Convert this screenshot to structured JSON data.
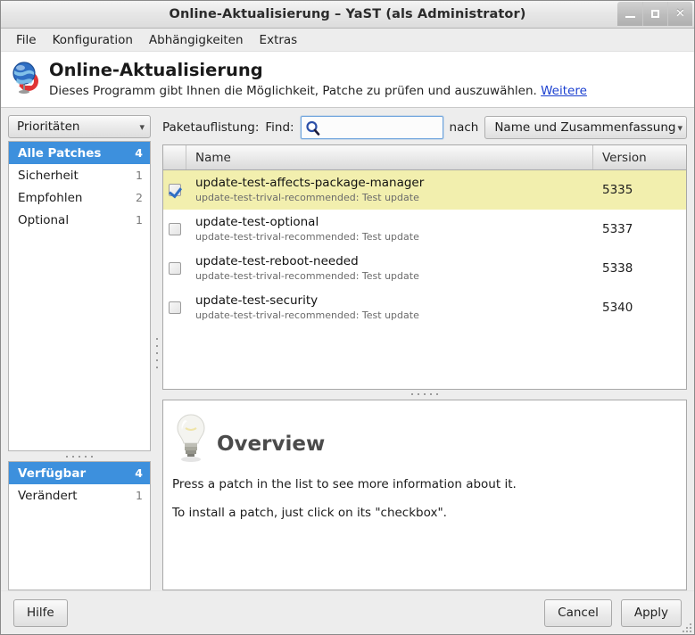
{
  "window": {
    "title": "Online-Aktualisierung – YaST (als Administrator)",
    "buttons": {
      "minimize": "minimize-icon",
      "maximize": "maximize-icon",
      "close": "✕"
    }
  },
  "menubar": {
    "items": [
      {
        "label": "File"
      },
      {
        "label": "Konfiguration"
      },
      {
        "label": "Abhängigkeiten"
      },
      {
        "label": "Extras"
      }
    ]
  },
  "heading": {
    "icon": "globe-update-icon",
    "title": "Online-Aktualisierung",
    "subtitle": "Dieses Programm gibt Ihnen die Möglichkeit, Patche zu prüfen und auszuwählen.",
    "more_link": "Weitere"
  },
  "sidebar": {
    "filter_combo": {
      "label": "Prioritäten",
      "chevron": "chevron-down-icon"
    },
    "priorities": [
      {
        "label": "Alle Patches",
        "count": "4",
        "selected": true
      },
      {
        "label": "Sicherheit",
        "count": "1",
        "selected": false
      },
      {
        "label": "Empfohlen",
        "count": "2",
        "selected": false
      },
      {
        "label": "Optional",
        "count": "1",
        "selected": false
      }
    ],
    "states": [
      {
        "label": "Verfügbar",
        "count": "4",
        "selected": true
      },
      {
        "label": "Verändert",
        "count": "1",
        "selected": false
      }
    ]
  },
  "filter_bar": {
    "section_label": "Paketauflistung:",
    "find_label": "Find:",
    "search_icon": "magnifier-icon",
    "search_value": "",
    "search_placeholder": "",
    "nach_label": "nach",
    "sort_combo": {
      "value": "Name und Zusammenfassung",
      "chevron": "chevron-down-icon"
    }
  },
  "table": {
    "columns": [
      "",
      "Name",
      "Version"
    ],
    "rows": [
      {
        "checked": true,
        "selected": true,
        "name": "update-test-affects-package-manager",
        "summary": "update-test-trival-recommended: Test update",
        "version": "5335"
      },
      {
        "checked": false,
        "selected": false,
        "name": "update-test-optional",
        "summary": "update-test-trival-recommended: Test update",
        "version": "5337"
      },
      {
        "checked": false,
        "selected": false,
        "name": "update-test-reboot-needed",
        "summary": "update-test-trival-recommended: Test update",
        "version": "5338"
      },
      {
        "checked": false,
        "selected": false,
        "name": "update-test-security",
        "summary": "update-test-trival-recommended: Test update",
        "version": "5340"
      }
    ]
  },
  "info_panel": {
    "icon": "lightbulb-icon",
    "title": "Overview",
    "line1": "Press a patch in the list to see more information about it.",
    "line2": "To install a patch, just click on its \"checkbox\"."
  },
  "footer": {
    "help_label": "Hilfe",
    "cancel_label": "Cancel",
    "apply_label": "Apply"
  },
  "colors": {
    "selection_blue": "#3d90dd",
    "row_highlight_yellow": "#f2efae",
    "link_blue": "#1a3fd0",
    "window_bg": "#ededed",
    "panel_bg": "#ffffff"
  }
}
